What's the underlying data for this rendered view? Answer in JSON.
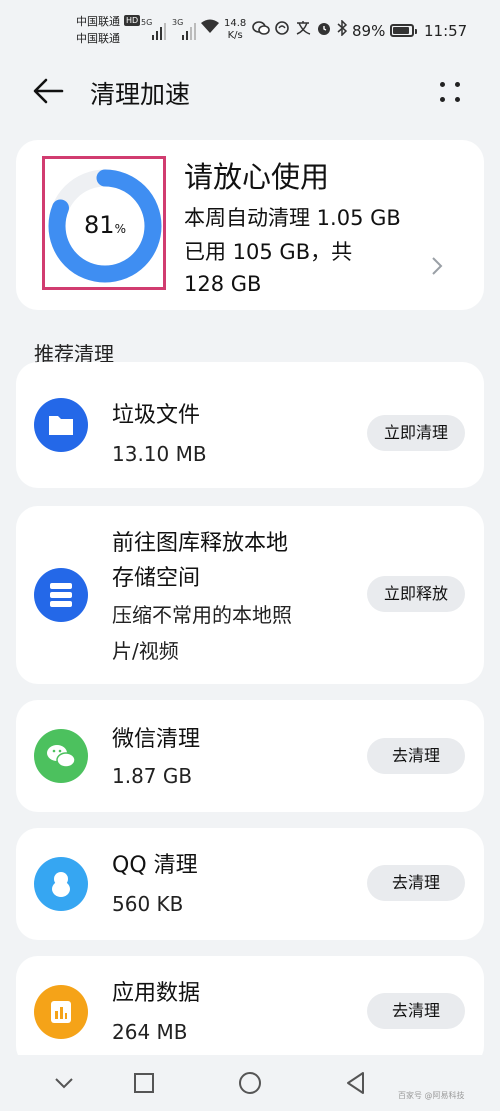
{
  "status_bar": {
    "carrier1": "中国联通",
    "carrier2": "中国联通",
    "hd_label": "HD",
    "net1": "5G",
    "net2": "3G",
    "speed_value": "14.8",
    "speed_unit": "K/s",
    "battery_percent": "89%",
    "battery_level": 0.89,
    "time": "11:57"
  },
  "header": {
    "title": "清理加速",
    "back_icon": "arrow-left-icon",
    "more_icon": "more-grid-icon"
  },
  "summary": {
    "percent_value": "81",
    "percent_sign": "%",
    "used_fraction": 0.81,
    "heading": "请放心使用",
    "weekly_cleanup": "本周自动清理 1.05 GB",
    "usage_line1": "已用 105 GB，共",
    "usage_line2": "128 GB",
    "ring_color": "#3f8ef2",
    "ring_track_color": "#eef0f3",
    "highlight_color": "#d13c70"
  },
  "section_title": "推荐清理",
  "items": [
    {
      "title": "垃圾文件",
      "subtitle": "13.10 MB",
      "action": "立即清理",
      "icon": "folder-icon",
      "color": "#2468e8"
    },
    {
      "title_line1": "前往图库释放本地",
      "title_line2": "存储空间",
      "subtitle_line1": "压缩不常用的本地照",
      "subtitle_line2": "片/视频",
      "action": "立即释放",
      "icon": "storage-icon",
      "color": "#2468e8"
    },
    {
      "title": "微信清理",
      "subtitle": "1.87 GB",
      "action": "去清理",
      "icon": "wechat-icon",
      "color": "#4cc15e"
    },
    {
      "title": "QQ 清理",
      "subtitle": "560 KB",
      "action": "去清理",
      "icon": "qq-penguin-icon",
      "color": "#36a6f2"
    },
    {
      "title": "应用数据",
      "subtitle": "264 MB",
      "action": "去清理",
      "icon": "app-data-icon",
      "color": "#f5a318"
    }
  ],
  "watermark": "百家号 @阿易科技"
}
